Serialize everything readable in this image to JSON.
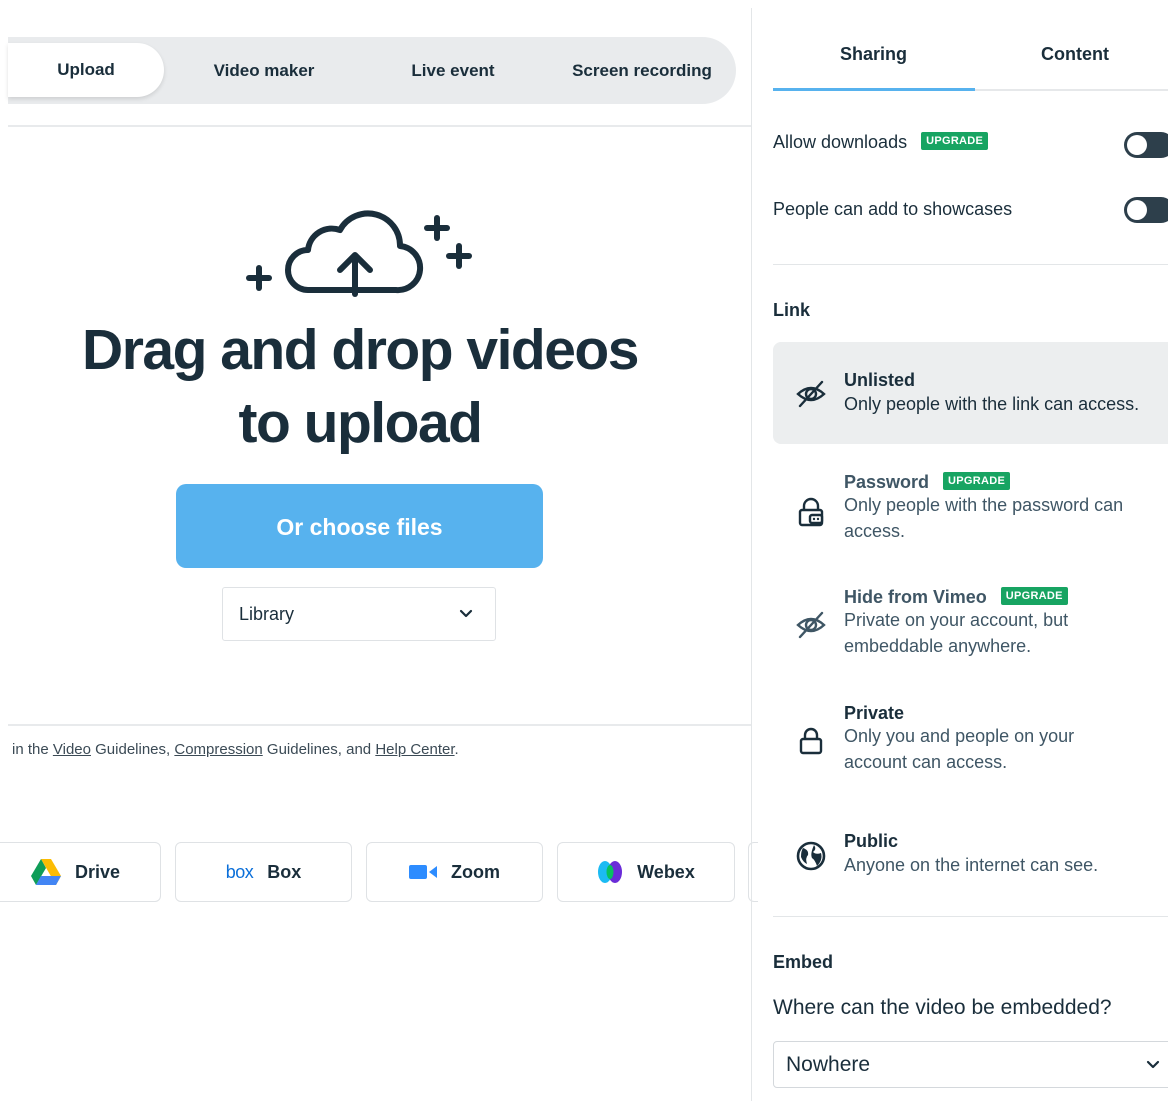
{
  "upload_tabs": [
    "Upload",
    "Video maker",
    "Live event",
    "Screen recording"
  ],
  "headline": [
    "Drag and drop videos",
    "to upload"
  ],
  "choose_button": "Or choose files",
  "destination_select": "Library",
  "guidelines": {
    "prefix": "in the ",
    "link1": "Video",
    "mid1": " Guidelines, ",
    "link2": "Compression",
    "mid2": " Guidelines, and ",
    "link3": "Help Center",
    "suffix": "."
  },
  "services": [
    {
      "label": "Drive",
      "icon": "google-drive-icon"
    },
    {
      "label": "Box",
      "icon": "box-logo",
      "logo_text": "box"
    },
    {
      "label": "Zoom",
      "icon": "zoom-icon"
    },
    {
      "label": "Webex",
      "icon": "webex-icon"
    }
  ],
  "settings_tabs": [
    "Sharing",
    "Content"
  ],
  "sharing": {
    "allow_downloads": "Allow downloads",
    "add_to_showcases": "People can add to showcases",
    "upgrade_badge": "UPGRADE"
  },
  "link_section": {
    "title": "Link",
    "options": [
      {
        "title": "Unlisted",
        "desc": "Only people with the link can access.",
        "icon": "eye-off-icon",
        "selected": true
      },
      {
        "title": "Password",
        "desc": "Only people with the password can access.",
        "icon": "password-lock-icon",
        "upgrade": true
      },
      {
        "title": "Hide from Vimeo",
        "desc": "Private on your account, but embeddable anywhere.",
        "icon": "eye-off-icon",
        "upgrade": true
      },
      {
        "title": "Private",
        "desc": "Only you and people on your account can access.",
        "icon": "lock-icon"
      },
      {
        "title": "Public",
        "desc": "Anyone on the internet can see.",
        "icon": "globe-icon"
      }
    ]
  },
  "embed_section": {
    "title": "Embed",
    "question": "Where can the video be embedded?",
    "selected": "Nowhere"
  },
  "colors": {
    "accent": "#57b2ee",
    "upgrade": "#17a462",
    "text": "#1a2e3b"
  }
}
